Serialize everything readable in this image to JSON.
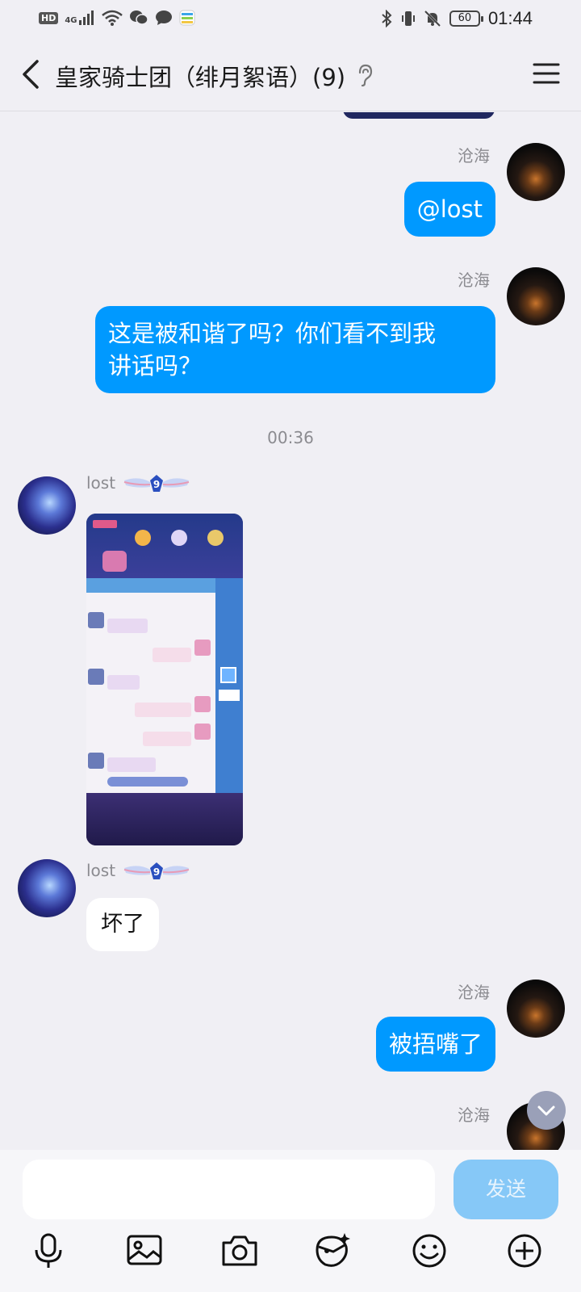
{
  "status_bar": {
    "hd": "HD",
    "network": "4G",
    "battery": "60",
    "time": "01:44"
  },
  "header": {
    "title": "皇家骑士团（绯月絮语）(9)"
  },
  "messages": [
    {
      "type": "outgoing",
      "sender": "沧海",
      "text": "@lost"
    },
    {
      "type": "outgoing",
      "sender": "沧海",
      "text": "这是被和谐了吗？你们看不到我\n讲话吗？"
    },
    {
      "type": "time",
      "text": "00:36"
    },
    {
      "type": "incoming",
      "sender": "lost",
      "badge_level": "9",
      "image": true
    },
    {
      "type": "incoming",
      "sender": "lost",
      "badge_level": "9",
      "text": "坏了"
    },
    {
      "type": "outgoing",
      "sender": "沧海",
      "text": "被捂嘴了"
    },
    {
      "type": "outgoing",
      "sender": "沧海",
      "text": ""
    }
  ],
  "input": {
    "placeholder": "",
    "send_label": "发送"
  },
  "toolbar": [
    "mic-icon",
    "image-icon",
    "camera-icon",
    "sticker-icon",
    "emoji-icon",
    "plus-icon"
  ],
  "colors": {
    "bubble_out": "#0099ff",
    "bubble_in": "#ffffff",
    "background": "#f0eff4",
    "send_disabled": "#86c8f7"
  }
}
